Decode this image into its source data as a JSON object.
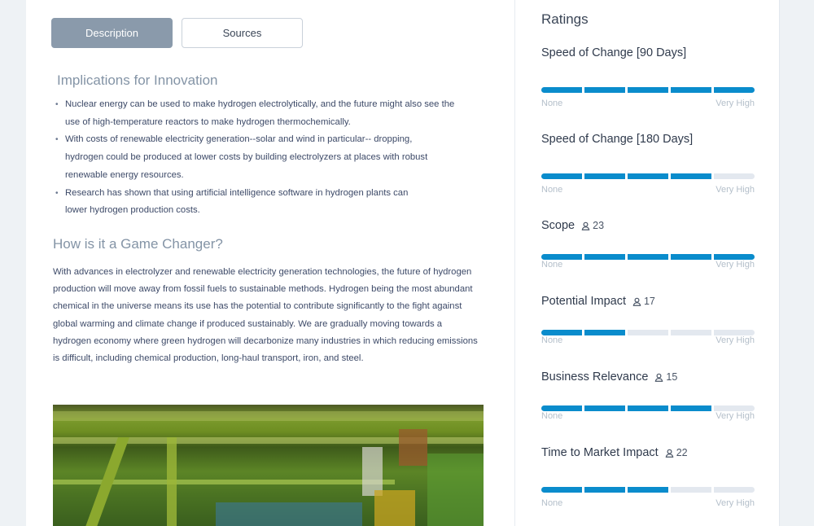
{
  "tabs": [
    {
      "label": "Description",
      "active": true
    },
    {
      "label": "Sources",
      "active": false
    }
  ],
  "implications": {
    "heading": "Implications for Innovation",
    "bullets": [
      "Nuclear energy can be used to make hydrogen electrolytically, and the future might also see the use of high-temperature reactors to make hydrogen thermochemically.",
      "With costs of renewable electricity generation--solar and wind in particular-- dropping, hydrogen could be produced at lower costs by building electrolyzers at places with robust renewable energy resources.",
      "Research has shown that using artificial intelligence software in hydrogen plants can lower hydrogen production costs."
    ]
  },
  "game_changer": {
    "heading": "How is it a Game Changer?",
    "body": "With advances in electrolyzer and renewable electricity generation technologies, the future of hydrogen production will move away from fossil fuels to sustainable methods. Hydrogen being the most abundant chemical in the universe means its use has the potential to contribute significantly to the fight against global warming and climate change if produced sustainably. We are gradually moving towards a hydrogen economy where green hydrogen will decarbonize many industries in which reducing emissions is difficult, including chemical production, long-haul transport, iron, and steel."
  },
  "image": {
    "description": "Industrial hydrogen plant piping (green/yellow structures)"
  },
  "ratings": {
    "title": "Ratings",
    "scale_min": "None",
    "scale_max": "Very High",
    "segments_total": 5,
    "items": [
      {
        "label": "Speed of Change [90 Days]",
        "count": null,
        "value": 5
      },
      {
        "label": "Speed of Change [180 Days]",
        "count": null,
        "value": 4
      },
      {
        "label": "Scope",
        "count": "23",
        "value": 5
      },
      {
        "label": "Potential Impact",
        "count": "17",
        "value": 2
      },
      {
        "label": "Business Relevance",
        "count": "15",
        "value": 4
      },
      {
        "label": "Time to Market Impact",
        "count": "22",
        "value": 3
      }
    ]
  },
  "colors": {
    "accent": "#0a8ccc",
    "inactive_segment": "#e3e8ef",
    "tab_active": "#8a9aab"
  }
}
